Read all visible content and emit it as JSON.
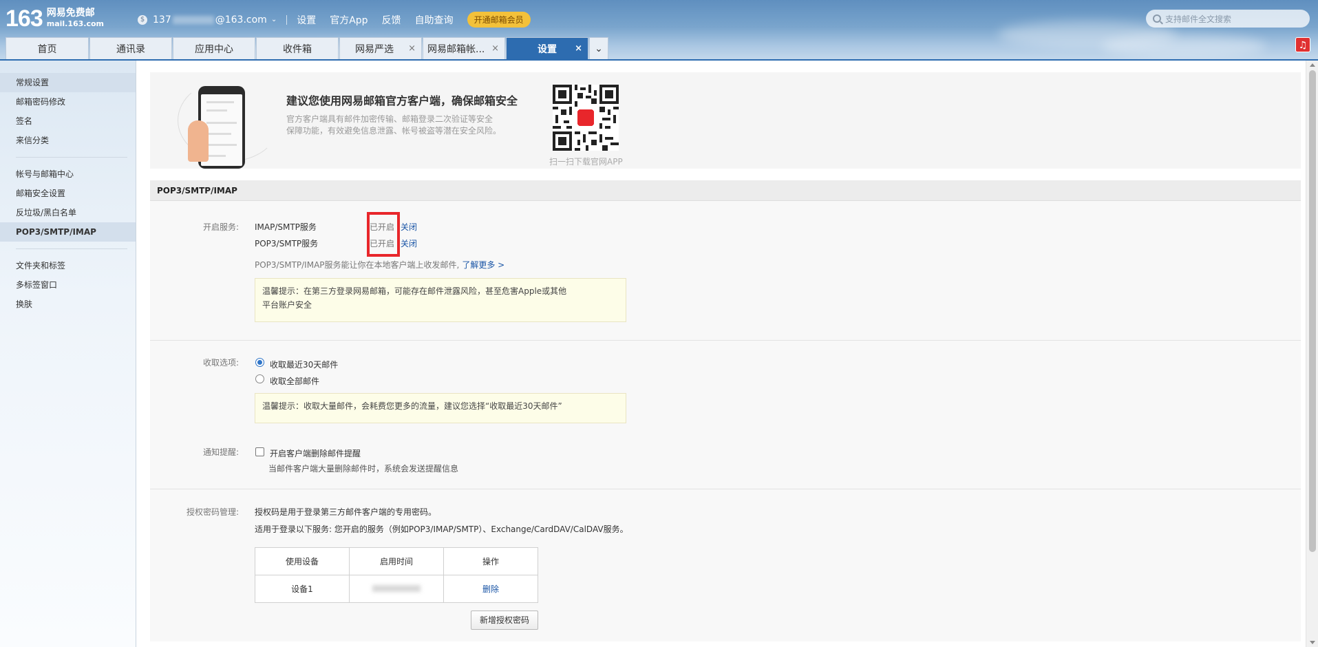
{
  "brand": {
    "logo_number": "163",
    "logo_title": "网易免费邮",
    "logo_domain": "mail.163.com"
  },
  "topnav": {
    "account_prefix": "137",
    "account_suffix": "@163.com",
    "links": [
      "设置",
      "官方App",
      "反馈",
      "自助查询"
    ],
    "vip_label": "开通邮箱会员"
  },
  "search": {
    "placeholder": "支持邮件全文搜索"
  },
  "tabs": [
    {
      "label": "首页"
    },
    {
      "label": "通讯录"
    },
    {
      "label": "应用中心"
    },
    {
      "label": "收件箱"
    },
    {
      "label": "网易严选",
      "closable": true
    },
    {
      "label": "网易邮箱帐...",
      "closable": true
    },
    {
      "label": "设置",
      "closable": true,
      "active": true
    }
  ],
  "sidebar": {
    "group1": [
      "常规设置",
      "邮箱密码修改",
      "签名",
      "来信分类"
    ],
    "group2": [
      "帐号与邮箱中心",
      "邮箱安全设置",
      "反垃圾/黑白名单",
      "POP3/SMTP/IMAP"
    ],
    "group3": [
      "文件夹和标签",
      "多标签窗口",
      "换肤"
    ]
  },
  "banner": {
    "title": "建议您使用网易邮箱官方客户端，确保邮箱安全",
    "desc_line1": "官方客户端具有邮件加密传输、邮箱登录二次验证等安全",
    "desc_line2": "保障功能，有效避免信息泄露、帐号被盗等潜在安全风险。",
    "qr_caption": "扫一扫下载官网APP"
  },
  "section": {
    "title": "POP3/SMTP/IMAP",
    "services_label": "开启服务:",
    "services": [
      {
        "name": "IMAP/SMTP服务",
        "status": "已开启",
        "action": "关闭"
      },
      {
        "name": "POP3/SMTP服务",
        "status": "已开启",
        "action": "关闭"
      }
    ],
    "service_note": "POP3/SMTP/IMAP服务能让你在本地客户端上收发邮件,",
    "learn_more": "了解更多 >",
    "tip1_line1": "温馨提示：在第三方登录网易邮箱，可能存在邮件泄露风险，甚至危害Apple或其他",
    "tip1_line2": "平台账户安全",
    "receive_label": "收取选项:",
    "receive_opt1": "收取最近30天邮件",
    "receive_opt2": "收取全部邮件",
    "tip2": "温馨提示：收取大量邮件，会耗费您更多的流量，建议您选择“收取最近30天邮件”",
    "notify_label": "通知提醒:",
    "notify_option": "开启客户端删除邮件提醒",
    "notify_desc": "当邮件客户端大量删除邮件时，系统会发送提醒信息",
    "auth_label": "授权密码管理:",
    "auth_desc1": "授权码是用于登录第三方邮件客户端的专用密码。",
    "auth_desc2": "适用于登录以下服务: 您开启的服务（例如POP3/IMAP/SMTP）、Exchange/CardDAV/CalDAV服务。",
    "table_headers": [
      "使用设备",
      "启用时间",
      "操作"
    ],
    "table_rows": [
      {
        "device": "设备1",
        "action": "删除"
      }
    ],
    "add_button": "新增授权密码"
  }
}
